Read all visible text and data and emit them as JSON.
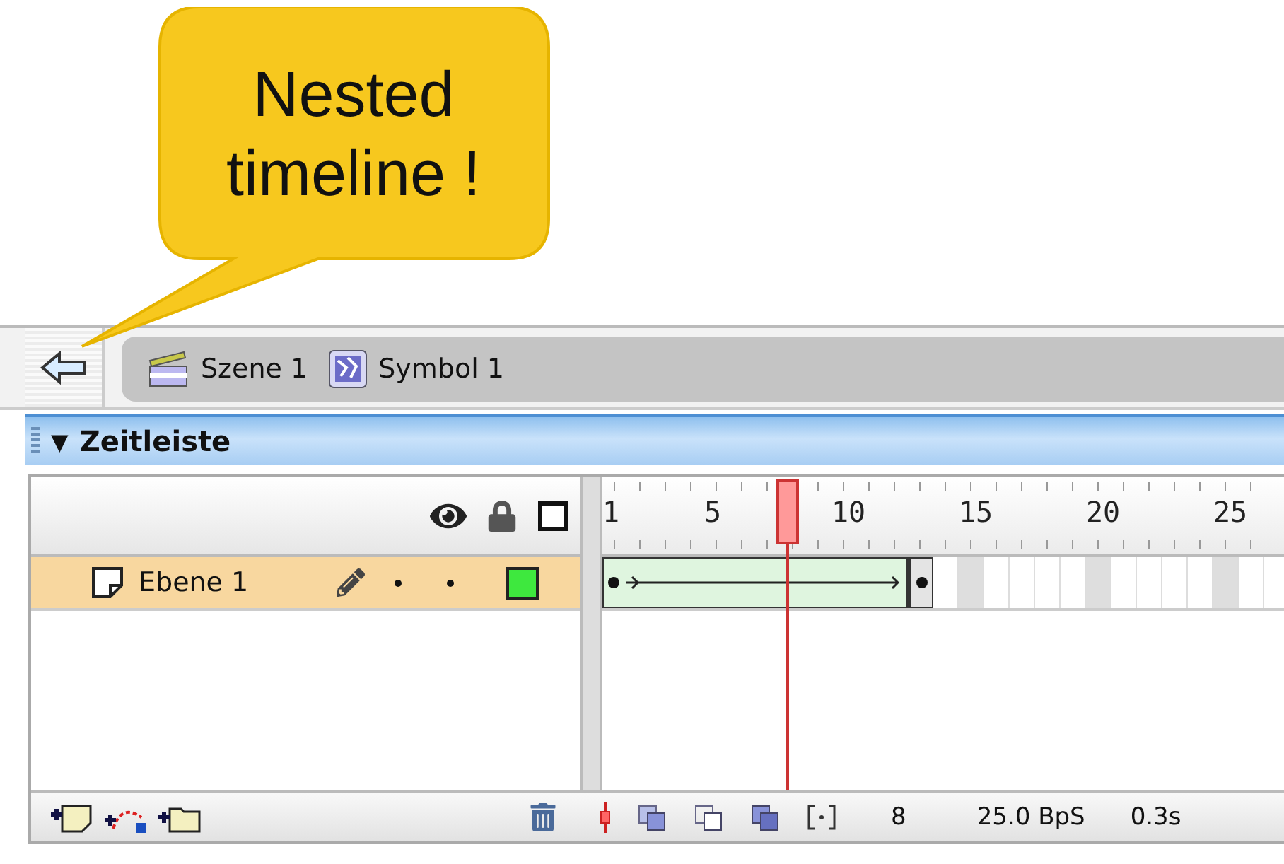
{
  "callout": {
    "text": "Nested timeline !"
  },
  "breadcrumb": [
    {
      "label": "Szene 1",
      "kind": "scene"
    },
    {
      "label": "Symbol 1",
      "kind": "symbol"
    }
  ],
  "panel": {
    "toggle": "▼",
    "title": "Zeitleiste"
  },
  "ruler": {
    "labels": [
      "1",
      "5",
      "10",
      "15",
      "20",
      "25"
    ]
  },
  "playhead": {
    "level": 0.27
  },
  "layers": [
    {
      "name": "Ebene 1",
      "selected": true,
      "color": "#3ee83e",
      "frames": [
        {
          "kind": "tween"
        },
        {
          "kind": "tween"
        },
        {
          "kind": "tween"
        },
        {
          "kind": "tween"
        },
        {
          "kind": "tween"
        },
        {
          "kind": "tween"
        },
        {
          "kind": "tween"
        },
        {
          "kind": "tween"
        },
        {
          "kind": "tween"
        },
        {
          "kind": "tween"
        },
        {
          "kind": "tween"
        },
        {
          "kind": "tween"
        },
        {
          "kind": "keyframe"
        }
      ]
    }
  ],
  "status": {
    "frame": "8",
    "rate": "25.0 BpS",
    "time": "0.3s"
  }
}
